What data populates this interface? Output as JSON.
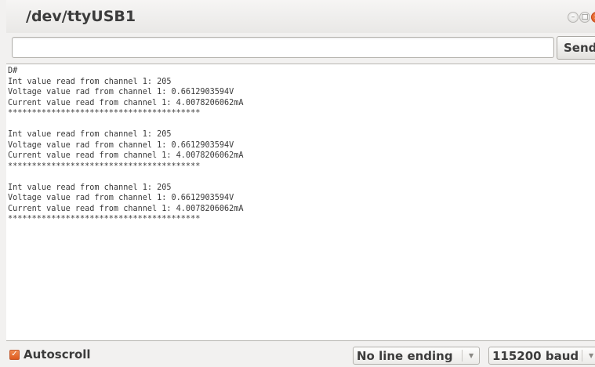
{
  "window": {
    "title": "/dev/ttyUSB1",
    "controls": {
      "minimize": "–",
      "maximize": "□",
      "close": "×"
    }
  },
  "input": {
    "value": "",
    "placeholder": "",
    "send_label": "Send"
  },
  "console": {
    "lines": [
      "D#",
      "Int value read from channel 1: 205",
      "Voltage value rad from channel 1: 0.6612903594V",
      "Current value read from channel 1: 4.0078206062mA",
      "****************************************",
      "",
      "Int value read from channel 1: 205",
      "Voltage value rad from channel 1: 0.6612903594V",
      "Current value read from channel 1: 4.0078206062mA",
      "****************************************",
      "",
      "Int value read from channel 1: 205",
      "Voltage value rad from channel 1: 0.6612903594V",
      "Current value read from channel 1: 4.0078206062mA",
      "****************************************"
    ]
  },
  "footer": {
    "autoscroll": {
      "label": "Autoscroll",
      "checked": true
    },
    "line_ending": {
      "selected": "No line ending"
    },
    "baud": {
      "selected": "115200 baud"
    }
  },
  "icons": {
    "checkbox": "checkmark-icon",
    "dropdown_arrow": "chevron-down-icon"
  },
  "colors": {
    "accent": "#e0601f",
    "window_bg": "#f2f1f0",
    "console_bg": "#ffffff"
  }
}
